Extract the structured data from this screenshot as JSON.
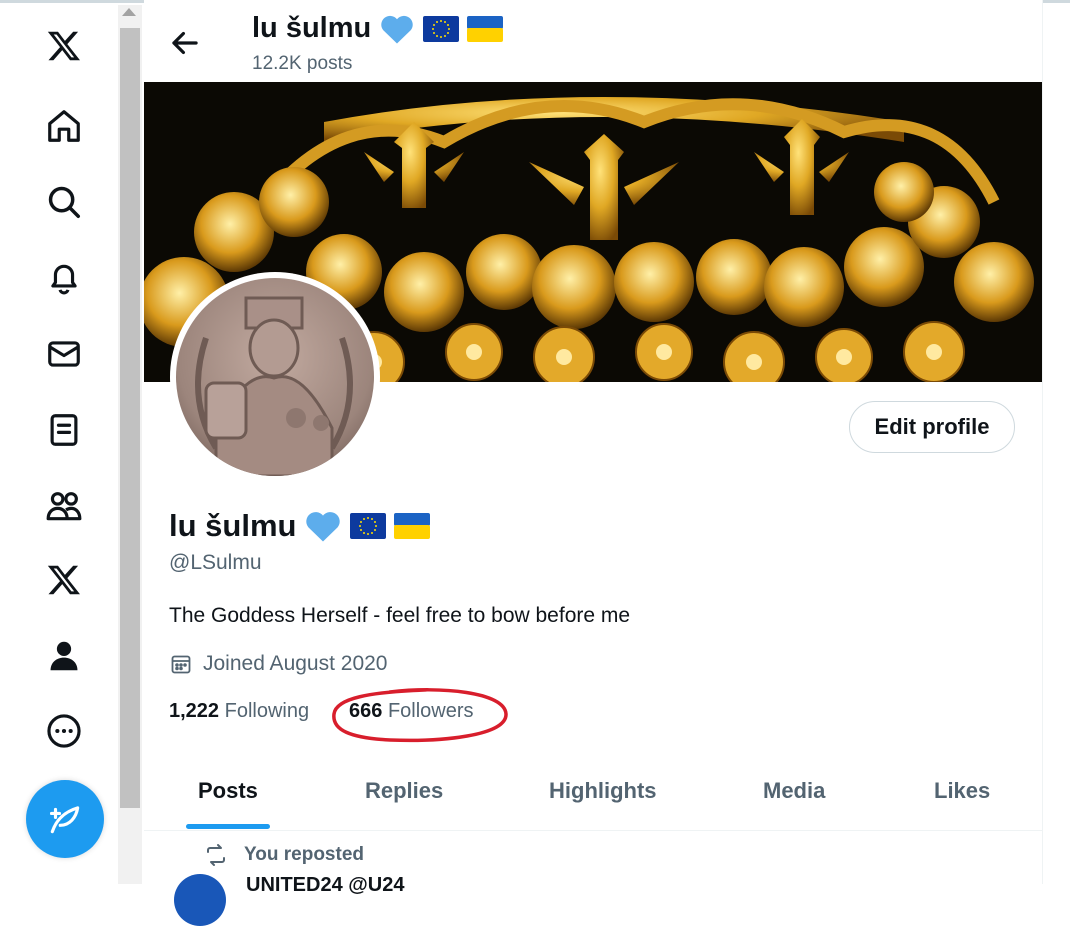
{
  "header": {
    "name": "lu šulmu",
    "posts_count": "12.2K posts"
  },
  "profile": {
    "display_name": "lu šulmu",
    "handle": "@LSulmu",
    "bio": "The Goddess Herself - feel free to bow before me",
    "joined": "Joined August 2020",
    "following_count": "1,222",
    "following_label": "Following",
    "followers_count": "666",
    "followers_label": "Followers",
    "edit_button": "Edit profile"
  },
  "tabs": [
    {
      "label": "Posts",
      "active": true
    },
    {
      "label": "Replies",
      "active": false
    },
    {
      "label": "Highlights",
      "active": false
    },
    {
      "label": "Media",
      "active": false
    },
    {
      "label": "Likes",
      "active": false
    }
  ],
  "feed": {
    "repost_label": "You reposted",
    "first_post_author_partial": "UNITED24 @U24"
  },
  "nav": {
    "icons": [
      "x-logo-icon",
      "home-icon",
      "search-icon",
      "bell-icon",
      "mail-icon",
      "lists-icon",
      "communities-icon",
      "premium-x-icon",
      "profile-icon",
      "more-icon",
      "compose-icon"
    ]
  },
  "colors": {
    "accent": "#1d9bf0",
    "annotation_circle": "#d81e2c",
    "secondary_text": "#536471"
  }
}
